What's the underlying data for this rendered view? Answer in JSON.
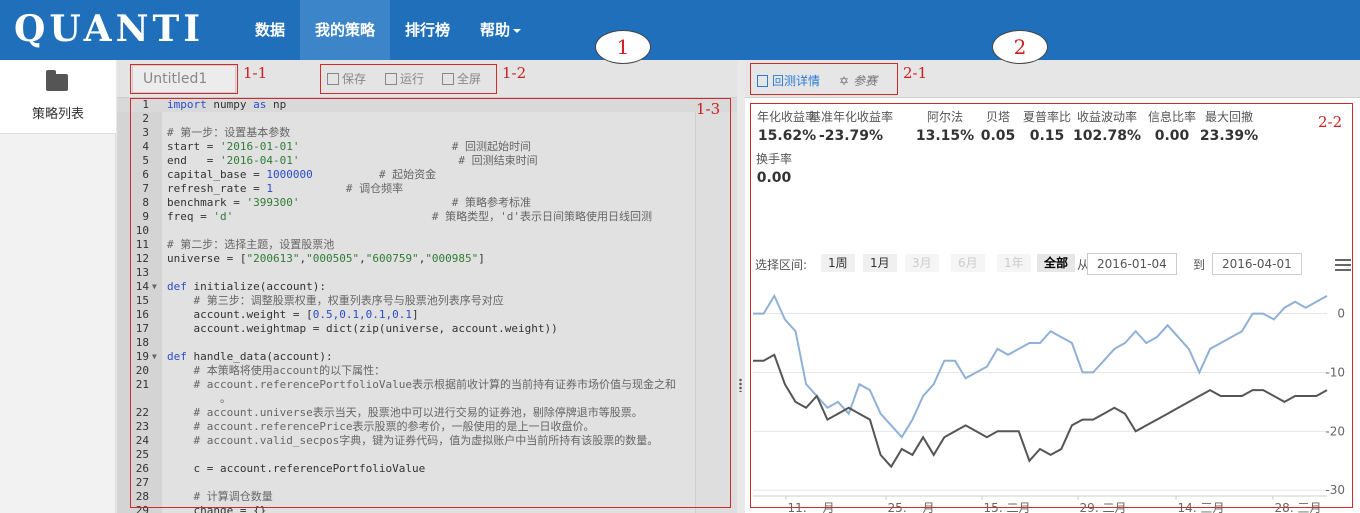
{
  "brand": {
    "logo_text": "QUANTI"
  },
  "nav": {
    "items": [
      {
        "label": "数据"
      },
      {
        "label": "我的策略",
        "active": true
      },
      {
        "label": "排行榜"
      },
      {
        "label": "帮助"
      }
    ]
  },
  "sidebar": {
    "item_label": "策略列表"
  },
  "editor": {
    "title": "Untitled1",
    "buttons": {
      "save": "保存",
      "run": "运行",
      "fullscreen": "全屏"
    },
    "code_lines": [
      "import numpy as np",
      "",
      "# 第一步：设置基本参数",
      "start = '2016-01-01'                       # 回测起始时间",
      "end   = '2016-04-01'                        # 回测结束时间",
      "capital_base = 1000000          # 起始资金",
      "refresh_rate = 1           # 调仓频率",
      "benchmark = '399300'                       # 策略参考标准",
      "freq = 'd'                              # 策略类型，'d'表示日间策略使用日线回测",
      "",
      "# 第二步：选择主题，设置股票池",
      "universe = [\"200613\",\"000505\",\"600759\",\"000985\"]",
      "",
      "def initialize(account):",
      "    # 第三步：调整股票权重，权重列表序号与股票池列表序号对应",
      "    account.weight = [0.5,0.1,0.1,0.1]",
      "    account.weightmap = dict(zip(universe, account.weight))",
      "",
      "def handle_data(account):",
      "    # 本策略将使用account的以下属性：",
      "    # account.referencePortfolioValue表示根据前收计算的当前持有证券市场价值与现金之和",
      "        。",
      "    # account.universe表示当天，股票池中可以进行交易的证券池，剔除停牌退市等股票。",
      "    # account.referencePrice表示股票的参考价，一般使用的是上一日收盘价。",
      "    # account.valid_secpos字典，键为证券代码，值为虚拟账户中当前所持有该股票的数量。",
      "",
      "    c = account.referencePortfolioValue",
      "",
      "    # 计算调仓数量",
      "    change = {}"
    ],
    "line_numbers": [
      "1",
      "2",
      "3",
      "4",
      "5",
      "6",
      "7",
      "8",
      "9",
      "10",
      "11",
      "12",
      "13",
      "14",
      "15",
      "16",
      "17",
      "18",
      "19",
      "20",
      "21",
      "",
      "22",
      "23",
      "24",
      "25",
      "26",
      "27",
      "28",
      "29"
    ]
  },
  "results": {
    "tabs": {
      "detail": "回测详情",
      "params": "参赛"
    },
    "stats": [
      {
        "label": "年化收益率",
        "value": "15.62%"
      },
      {
        "label": "基准年化收益率",
        "value": "-23.79%"
      },
      {
        "label": "阿尔法",
        "value": "13.15%"
      },
      {
        "label": "贝塔",
        "value": "0.05"
      },
      {
        "label": "夏普率比",
        "value": "0.15"
      },
      {
        "label": "收益波动率",
        "value": "102.78%"
      },
      {
        "label": "信息比率",
        "value": "0.00"
      },
      {
        "label": "最大回撤",
        "value": "23.39%"
      },
      {
        "label": "换手率",
        "value": "0.00"
      }
    ],
    "range": {
      "label": "选择区间:",
      "buttons": [
        "1周",
        "1月",
        "3月",
        "6月",
        "1年",
        "全部"
      ],
      "from_label": "从",
      "to_label": "到",
      "from_date": "2016-01-04",
      "to_date": "2016-04-01"
    }
  },
  "annotations": {
    "editor_number": "1",
    "results_number": "2",
    "labels": [
      "1-1",
      "1-2",
      "1-3",
      "2-1",
      "2-2"
    ]
  },
  "chart_data": {
    "type": "line",
    "x_tick_labels": [
      "11. 一月",
      "25. 一月",
      "15. 二月",
      "29. 二月",
      "14. 三月",
      "28. 三月"
    ],
    "y_tick_labels": [
      "0",
      "-10",
      "-20",
      "-30"
    ],
    "ylim": [
      -32,
      4
    ],
    "grid": true,
    "series": [
      {
        "color": "#8fb1d6",
        "values": [
          0,
          0,
          3,
          -1,
          -3,
          -12,
          -14,
          -16,
          -15,
          -17,
          -12,
          -13,
          -17,
          -19,
          -21,
          -18,
          -14,
          -12,
          -8,
          -8,
          -11,
          -10,
          -9,
          -6,
          -7,
          -6,
          -5,
          -5,
          -3,
          -4,
          -5,
          -10,
          -10,
          -8,
          -6,
          -5,
          -3,
          -5,
          -4,
          -2,
          -4,
          -6,
          -10,
          -6,
          -5,
          -4,
          -3,
          0,
          0,
          -1,
          1,
          2,
          1,
          2,
          3
        ]
      },
      {
        "color": "#555555",
        "values": [
          -8,
          -8,
          -7,
          -12,
          -15,
          -16,
          -14,
          -18,
          -17,
          -16,
          -17,
          -18,
          -24,
          -26,
          -23,
          -24,
          -21,
          -24,
          -21,
          -20,
          -19,
          -20,
          -21,
          -20,
          -20,
          -20,
          -25,
          -23,
          -24,
          -23,
          -19,
          -18,
          -18,
          -17,
          -16,
          -17,
          -20,
          -19,
          -18,
          -17,
          -16,
          -15,
          -14,
          -13,
          -14,
          -14,
          -14,
          -13,
          -13,
          -14,
          -15,
          -14,
          -14,
          -14,
          -13
        ]
      }
    ]
  }
}
